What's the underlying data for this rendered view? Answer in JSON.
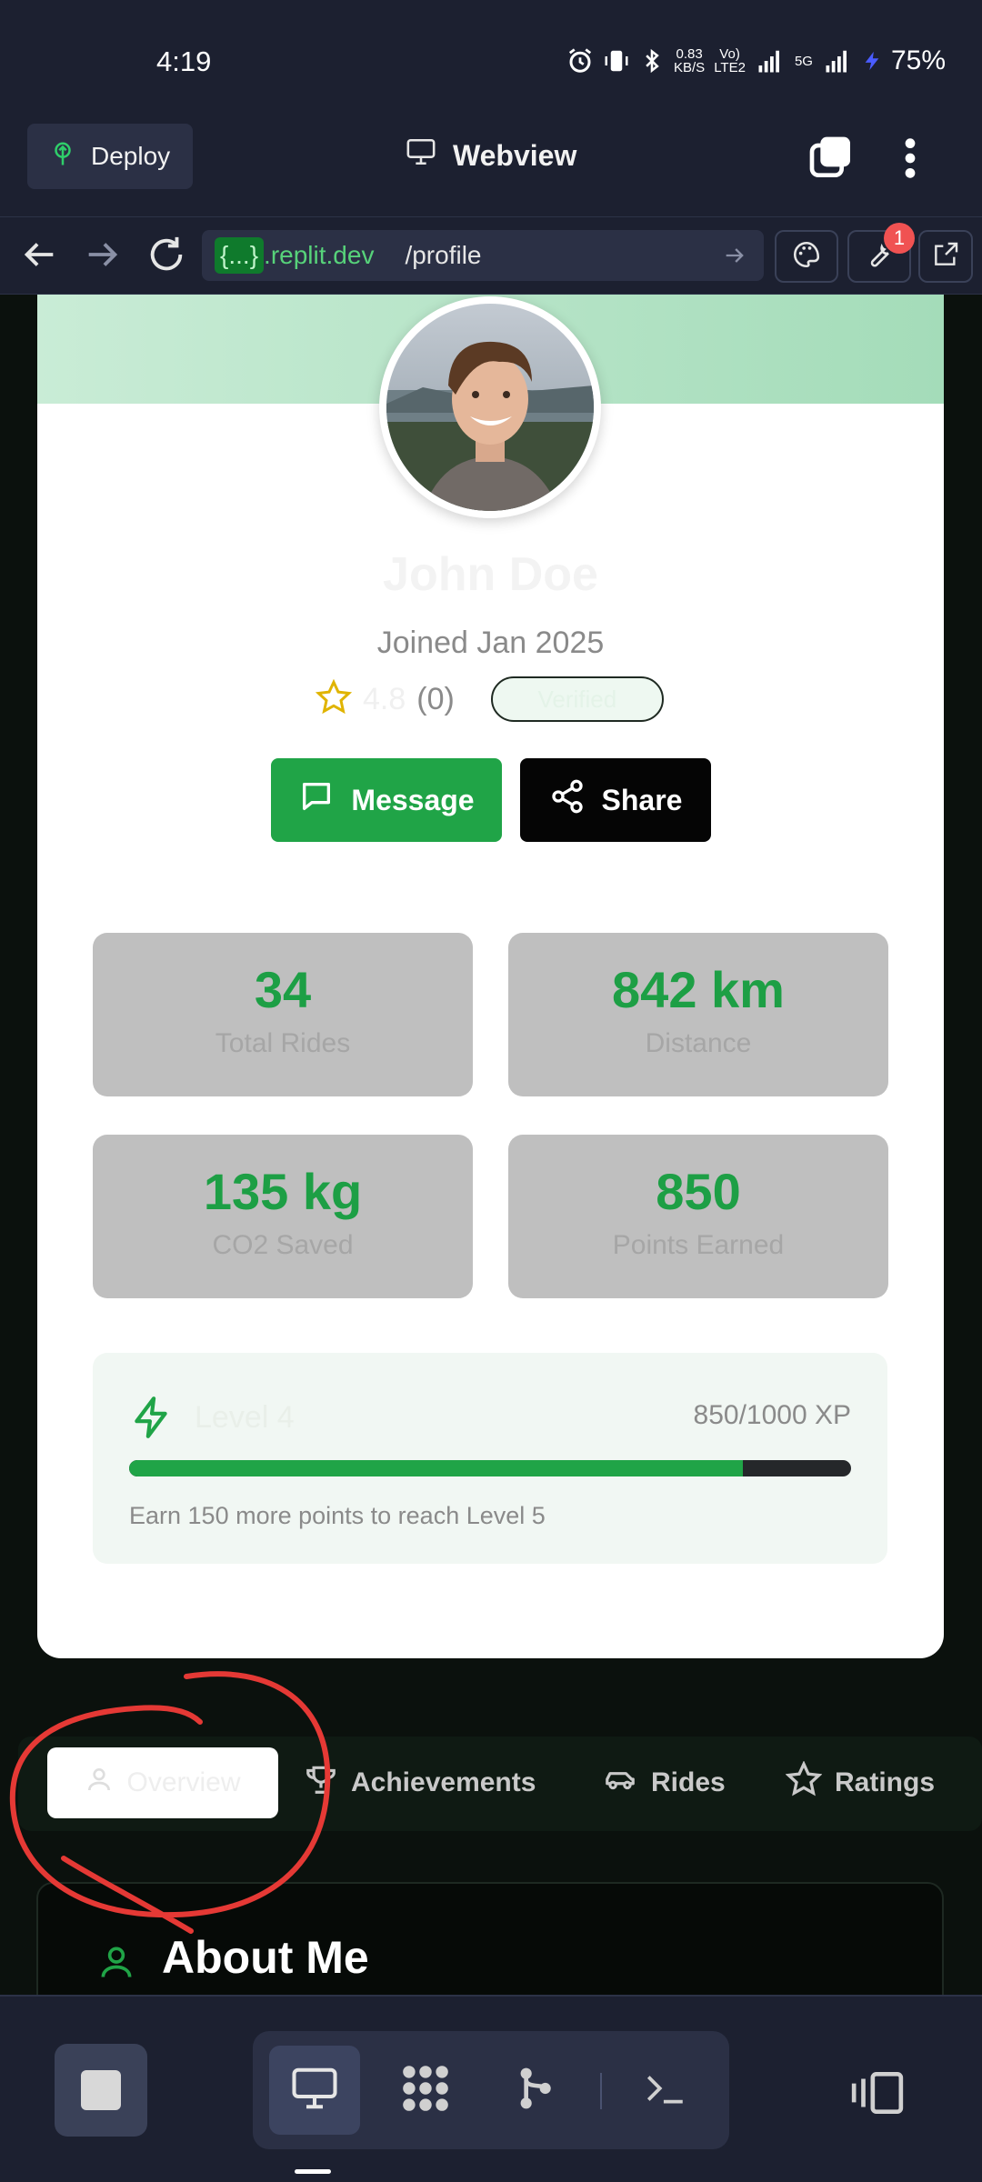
{
  "status_bar": {
    "time": "4:19",
    "net_speed_value": "0.83",
    "net_speed_unit": "KB/S",
    "volte_top": "Vo)",
    "volte_bottom": "LTE2",
    "network_label": "5G",
    "battery": "75%"
  },
  "header": {
    "deploy_label": "Deploy",
    "title": "Webview"
  },
  "url_bar": {
    "host_prefix": "{...}",
    "host_suffix": ".replit.dev",
    "path": "/profile",
    "devtools_badge": "1"
  },
  "profile": {
    "name": "John Doe",
    "joined": "Joined Jan 2025",
    "rating": "4.8",
    "rating_count": "(0)",
    "verified_label": "Verified",
    "message_label": "Message",
    "share_label": "Share"
  },
  "stats": [
    {
      "value": "34",
      "label": "Total Rides"
    },
    {
      "value": "842 km",
      "label": "Distance"
    },
    {
      "value": "135 kg",
      "label": "CO2 Saved"
    },
    {
      "value": "850",
      "label": "Points Earned"
    }
  ],
  "level": {
    "title": "Level 4",
    "xp": "850/1000 XP",
    "progress": 0.85,
    "hint": "Earn 150 more points to reach Level 5"
  },
  "tabs": [
    {
      "label": "Overview",
      "active": true
    },
    {
      "label": "Achievements",
      "active": false
    },
    {
      "label": "Rides",
      "active": false
    },
    {
      "label": "Ratings",
      "active": false
    }
  ],
  "about": {
    "title": "About Me"
  },
  "colors": {
    "brand_green": "#20a447",
    "annotation_red": "#e53935"
  }
}
